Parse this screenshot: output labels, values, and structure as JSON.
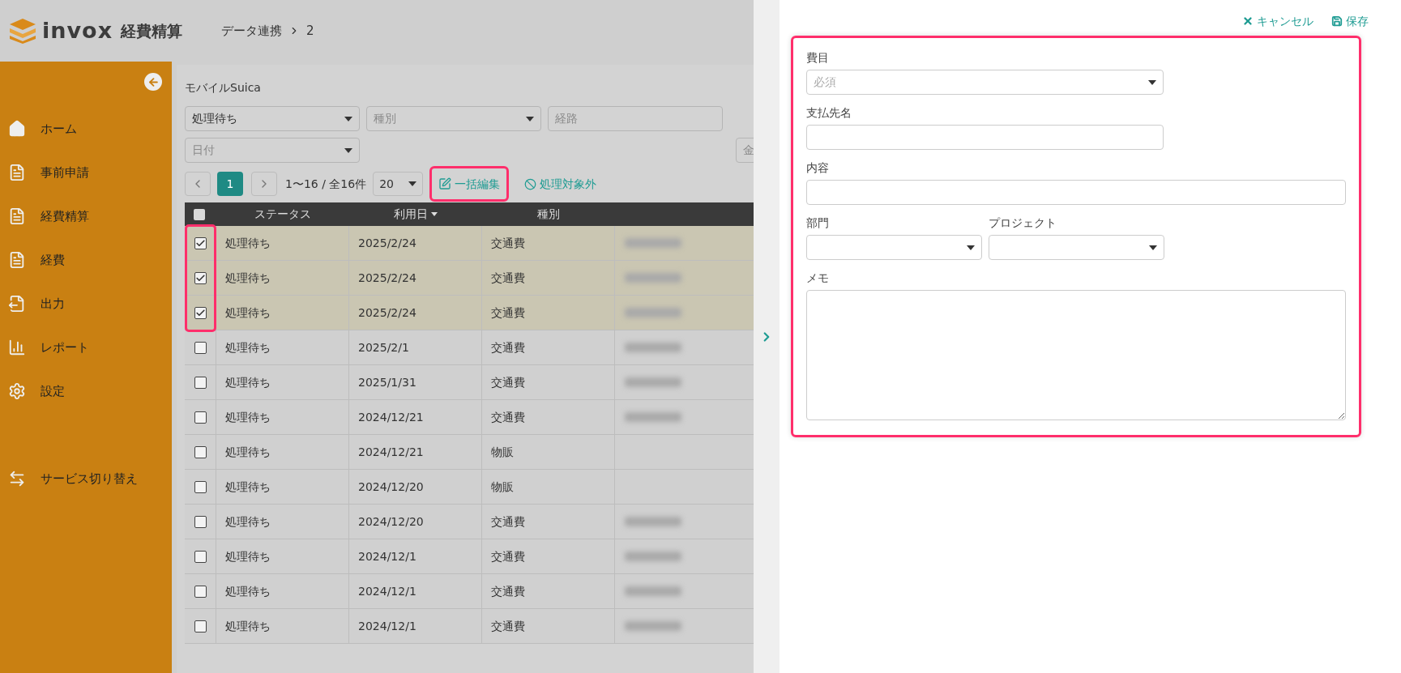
{
  "header": {
    "logo": "invox",
    "product": "経費精算",
    "breadcrumb": [
      "データ連携",
      "2"
    ]
  },
  "sidebar": {
    "items": [
      {
        "label": "ホーム",
        "kind": "home"
      },
      {
        "label": "事前申請",
        "kind": "doc"
      },
      {
        "label": "経費精算",
        "kind": "doc"
      },
      {
        "label": "経費",
        "kind": "doc"
      },
      {
        "label": "出力",
        "kind": "export"
      },
      {
        "label": "レポート",
        "kind": "report"
      },
      {
        "label": "設定",
        "kind": "settings"
      },
      {
        "label": "サービス切り替え",
        "kind": "switch"
      }
    ]
  },
  "main": {
    "title": "モバイルSuica",
    "filters": [
      {
        "value": "処理待ち",
        "kind": "select"
      },
      {
        "placeholder": "種別",
        "kind": "select"
      },
      {
        "placeholder": "経路",
        "kind": "input"
      },
      {
        "placeholder": "日付",
        "kind": "select"
      },
      {
        "placeholder": "金",
        "kind": "input"
      }
    ],
    "pager": {
      "pages": [
        {
          "label": "1",
          "selected": true
        }
      ],
      "range": "1〜16 / 全16件",
      "per_page": "20"
    },
    "actions": [
      {
        "label": "一括編集",
        "kind": "edit",
        "highlighted": true
      },
      {
        "label": "処理対象外",
        "kind": "exclude",
        "highlighted": false
      }
    ],
    "table": {
      "all_checked": false,
      "columns": [
        {
          "label": "ステータス",
          "sorted": false
        },
        {
          "label": "利用日",
          "sorted": true
        },
        {
          "label": "種別",
          "sorted": false
        }
      ],
      "rows": [
        {
          "checked": true,
          "highlighted": true,
          "status": "処理待ち",
          "date": "2025/2/24",
          "type": "交通費",
          "route_blurred": true
        },
        {
          "checked": true,
          "highlighted": true,
          "status": "処理待ち",
          "date": "2025/2/24",
          "type": "交通費",
          "route_blurred": true
        },
        {
          "checked": true,
          "highlighted": true,
          "status": "処理待ち",
          "date": "2025/2/24",
          "type": "交通費",
          "route_blurred": true
        },
        {
          "checked": false,
          "highlighted": false,
          "status": "処理待ち",
          "date": "2025/2/1",
          "type": "交通費",
          "route_blurred": true
        },
        {
          "checked": false,
          "highlighted": false,
          "status": "処理待ち",
          "date": "2025/1/31",
          "type": "交通費",
          "route_blurred": true
        },
        {
          "checked": false,
          "highlighted": false,
          "status": "処理待ち",
          "date": "2024/12/21",
          "type": "交通費",
          "route_blurred": true
        },
        {
          "checked": false,
          "highlighted": false,
          "status": "処理待ち",
          "date": "2024/12/21",
          "type": "物販",
          "route_blurred": false
        },
        {
          "checked": false,
          "highlighted": false,
          "status": "処理待ち",
          "date": "2024/12/20",
          "type": "物販",
          "route_blurred": false
        },
        {
          "checked": false,
          "highlighted": false,
          "status": "処理待ち",
          "date": "2024/12/20",
          "type": "交通費",
          "route_blurred": true
        },
        {
          "checked": false,
          "highlighted": false,
          "status": "処理待ち",
          "date": "2024/12/1",
          "type": "交通費",
          "route_blurred": true
        },
        {
          "checked": false,
          "highlighted": false,
          "status": "処理待ち",
          "date": "2024/12/1",
          "type": "交通費",
          "route_blurred": true
        },
        {
          "checked": false,
          "highlighted": false,
          "status": "処理待ち",
          "date": "2024/12/1",
          "type": "交通費",
          "route_blurred": true
        }
      ]
    }
  },
  "panel": {
    "actions": [
      {
        "label": "キャンセル",
        "kind": "cancel"
      },
      {
        "label": "保存",
        "kind": "save"
      }
    ],
    "form": {
      "highlighted": true,
      "rows": [
        [
          {
            "label": "費目",
            "kind": "select",
            "placeholder": "必須"
          }
        ],
        [
          {
            "label": "支払先名",
            "kind": "input"
          }
        ],
        [
          {
            "label": "内容",
            "kind": "input"
          }
        ],
        [
          {
            "label": "部門",
            "kind": "select"
          },
          {
            "label": "プロジェクト",
            "kind": "select"
          }
        ],
        [
          {
            "label": "メモ",
            "kind": "textarea"
          }
        ]
      ]
    }
  }
}
